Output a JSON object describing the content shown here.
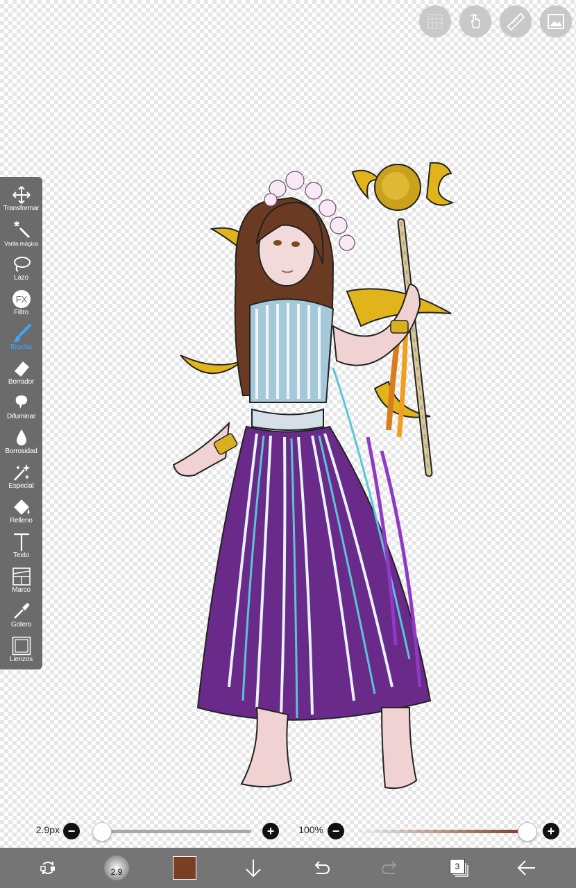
{
  "top_buttons": [
    {
      "name": "select-grid-button",
      "icon": "grid-select-icon"
    },
    {
      "name": "touch-mode-button",
      "icon": "hand-touch-icon"
    },
    {
      "name": "ruler-button",
      "icon": "ruler-icon"
    },
    {
      "name": "gallery-button",
      "icon": "image-icon"
    }
  ],
  "toolbar": {
    "tools": [
      {
        "label": "Transformar",
        "icon": "move-arrows-icon",
        "active": false
      },
      {
        "label": "Varita mágica",
        "icon": "magic-wand-icon",
        "active": false
      },
      {
        "label": "Lazo",
        "icon": "lasso-icon",
        "active": false
      },
      {
        "label": "Filtro",
        "icon": "fx-icon",
        "active": false
      },
      {
        "label": "Brocha",
        "icon": "brush-icon",
        "active": true
      },
      {
        "label": "Borrador",
        "icon": "eraser-icon",
        "active": false
      },
      {
        "label": "Difuminar",
        "icon": "smudge-icon",
        "active": false
      },
      {
        "label": "Borrosidad",
        "icon": "blur-drop-icon",
        "active": false
      },
      {
        "label": "Especial",
        "icon": "sparkle-icon",
        "active": false
      },
      {
        "label": "Relleno",
        "icon": "fill-bucket-icon",
        "active": false
      },
      {
        "label": "Texto",
        "icon": "text-icon",
        "active": false
      },
      {
        "label": "Marco",
        "icon": "frame-icon",
        "active": false
      },
      {
        "label": "Gotero",
        "icon": "eyedropper-icon",
        "active": false
      },
      {
        "label": "Lienzos",
        "icon": "canvas-icon",
        "active": false
      }
    ]
  },
  "brush_size": {
    "label": "2.9px",
    "value_fraction": 0.0
  },
  "opacity": {
    "label": "100%",
    "value_fraction": 1.0
  },
  "bottombar": {
    "brush_preview_value": "2.9",
    "current_color": "#7a3e24",
    "layer_count": "3"
  },
  "colors": {
    "toolbar_bg": "#6b6b6b",
    "bottombar_bg": "#757575",
    "active_tool": "#3ea8ff"
  }
}
